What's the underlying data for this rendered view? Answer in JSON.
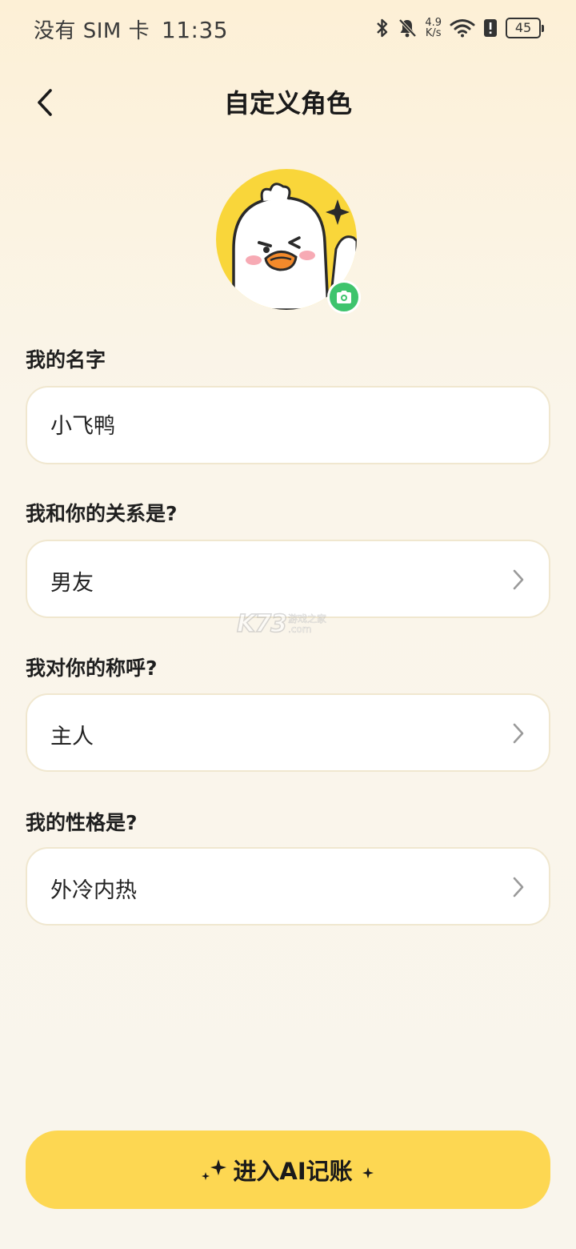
{
  "status_bar": {
    "carrier": "没有 SIM 卡",
    "time": "11:35",
    "net_speed_value": "4.9",
    "net_speed_unit": "K/s",
    "battery": "45"
  },
  "header": {
    "title": "自定义角色"
  },
  "form": {
    "name": {
      "label": "我的名字",
      "value": "小飞鸭"
    },
    "relationship": {
      "label": "我和你的关系是?",
      "value": "男友"
    },
    "address_as": {
      "label": "我对你的称呼?",
      "value": "主人"
    },
    "personality": {
      "label": "我的性格是?",
      "value": "外冷内热"
    }
  },
  "watermark": {
    "logo": "K73",
    "line1": "游戏之家",
    "line2": ".com"
  },
  "action": {
    "enter_label": "进入AI记账"
  },
  "colors": {
    "accent_yellow": "#fdd752",
    "camera_green": "#3ec46d",
    "field_border": "#f0e7cf"
  }
}
